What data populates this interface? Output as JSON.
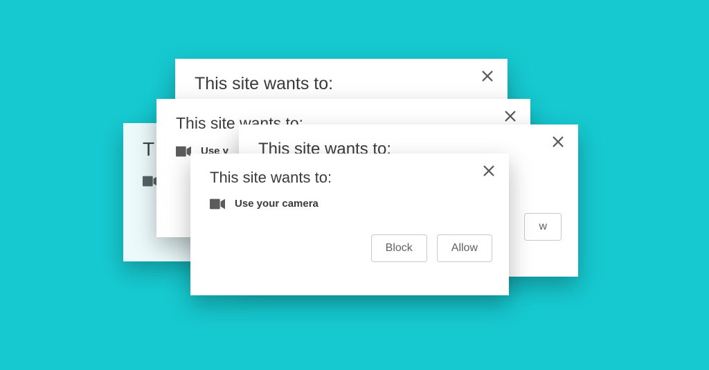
{
  "dialog": {
    "title": "This site wants to:",
    "title_partial_1": "T",
    "title_partial_3": "Use y",
    "permission_text": "Use your camera",
    "block_label": "Block",
    "allow_label": "Allow",
    "allow_partial": "w"
  },
  "icons": {
    "close": "close-icon",
    "camera": "camera-icon"
  }
}
